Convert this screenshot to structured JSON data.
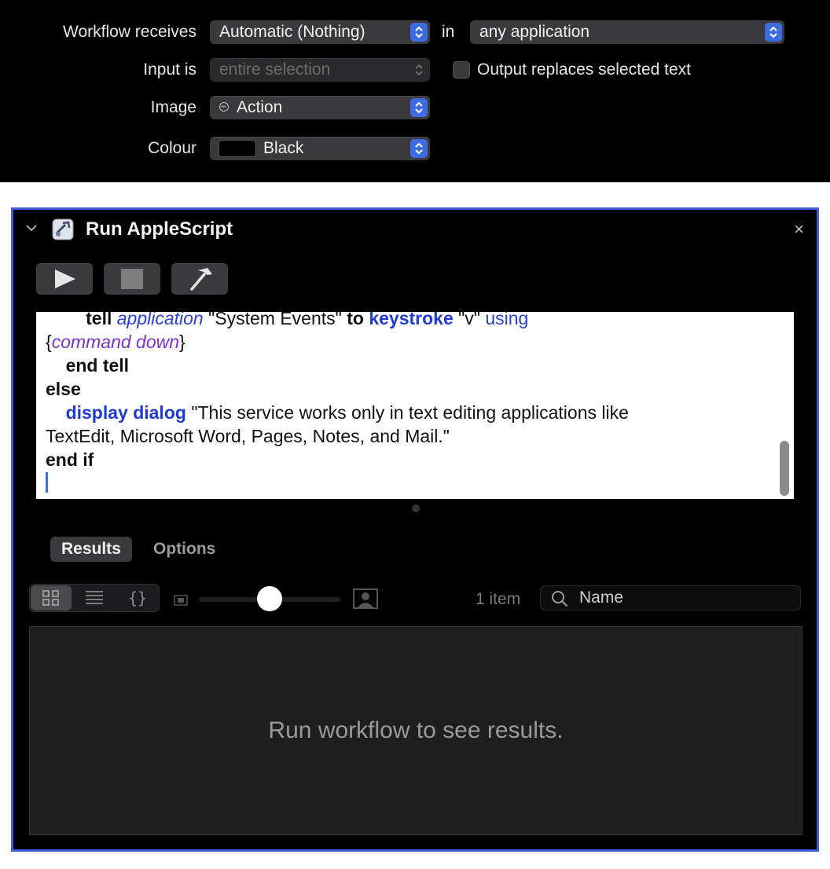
{
  "settings": {
    "workflow_receives_label": "Workflow receives",
    "workflow_receives_value": "Automatic (Nothing)",
    "in_label": "in",
    "application_value": "any application",
    "input_is_label": "Input is",
    "input_is_value": "entire selection",
    "output_replaces_label": "Output replaces selected text",
    "output_replaces_checked": false,
    "image_label": "Image",
    "image_value": "Action",
    "colour_label": "Colour",
    "colour_value": "Black",
    "colour_swatch": "#000000"
  },
  "action": {
    "title": "Run AppleScript",
    "close_glyph": "×",
    "accent_color": "#3b62d6"
  },
  "script": {
    "line1": {
      "indent": "        ",
      "kw_tell": "tell",
      "cls_application": "application",
      "str_system_events": " \"System Events\" ",
      "kw_to": "to",
      "cmd_keystroke": "keystroke",
      "str_v": " \"v\" ",
      "prm_using": "using"
    },
    "line2": {
      "open": "{",
      "enm_command_down": "command down",
      "close": "}"
    },
    "line3": {
      "indent": "    ",
      "kw_end_tell": "end tell"
    },
    "line4": {
      "kw_else": "else"
    },
    "line5": {
      "indent": "    ",
      "cmd_display_dialog": "display dialog",
      "str_part1": " \"This service works only in text editing applications like"
    },
    "line6": {
      "text": "TextEdit, Microsoft Word, Pages, Notes, and Mail.\""
    },
    "line7": {
      "kw_end_if": "end if"
    }
  },
  "tabs": [
    {
      "label": "Results",
      "selected": true
    },
    {
      "label": "Options",
      "selected": false
    }
  ],
  "results": {
    "item_count": "1 item",
    "search_placeholder": "Name",
    "empty_message": "Run workflow to see results."
  }
}
